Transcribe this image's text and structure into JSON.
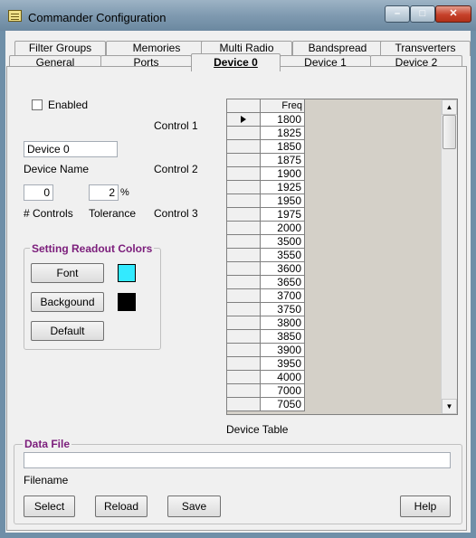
{
  "window": {
    "title": "Commander Configuration",
    "min_glyph": "–",
    "max_glyph": "□",
    "close_glyph": "✕"
  },
  "tabs_row_back": [
    "Filter Groups",
    "Memories",
    "Multi Radio",
    "Bandspread",
    "Transverters"
  ],
  "tabs_row_front": [
    "General",
    "Ports",
    "Device 0",
    "Device 1",
    "Device 2"
  ],
  "active_tab": "Device 0",
  "device": {
    "enabled_label": "Enabled",
    "device_name_value": "Device 0",
    "device_name_label": "Device Name",
    "controls_value": "0",
    "controls_label": "# Controls",
    "tolerance_value": "2",
    "tolerance_unit": "%",
    "tolerance_label": "Tolerance",
    "control1": "Control 1",
    "control2": "Control 2",
    "control3": "Control 3"
  },
  "colors": {
    "title": "Setting Readout Colors",
    "font_button": "Font",
    "background_button": "Backgound",
    "default_button": "Default",
    "font_color": "#33eaff",
    "background_color": "#000000"
  },
  "table": {
    "header": "Freq",
    "rows": [
      "1800",
      "1825",
      "1850",
      "1875",
      "1900",
      "1925",
      "1950",
      "1975",
      "2000",
      "3500",
      "3550",
      "3600",
      "3650",
      "3700",
      "3750",
      "3800",
      "3850",
      "3900",
      "3950",
      "4000",
      "7000",
      "7050"
    ],
    "caption": "Device Table",
    "scroll_up": "▲",
    "scroll_down": "▼"
  },
  "datafile": {
    "title": "Data File",
    "filename_value": "",
    "filename_label": "Filename",
    "select_button": "Select",
    "reload_button": "Reload",
    "save_button": "Save",
    "help_button": "Help"
  }
}
